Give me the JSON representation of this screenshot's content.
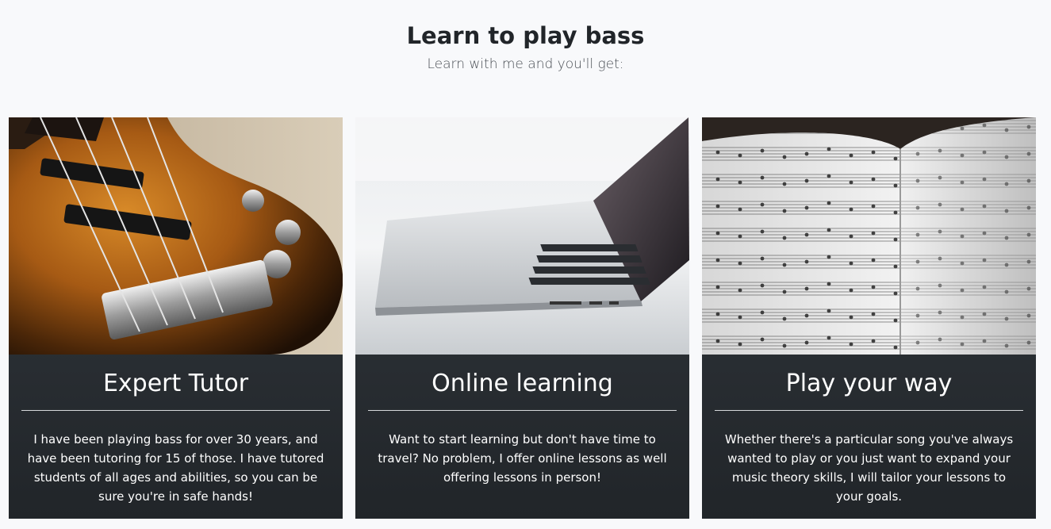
{
  "header": {
    "title": "Learn to play bass",
    "subtitle": "Learn with me and you'll get:"
  },
  "cards": [
    {
      "image": "bass-guitar-photo",
      "title": "Expert Tutor",
      "text": "I have been playing bass for over 30 years, and have been tutoring for 15 of those. I have tutored students of all ages and abilities, so you can be sure you're in safe hands!"
    },
    {
      "image": "laptop-photo",
      "title": "Online learning",
      "text": "Want to start learning but don't have time to travel? No problem, I offer online lessons as well offering lessons in person!"
    },
    {
      "image": "sheet-music-photo",
      "title": "Play your way",
      "text": "Whether there's a particular song you've always wanted to play or you just want to expand your music theory skills, I will tailor your lessons to your goals."
    }
  ],
  "colors": {
    "page_background": "#f8f9fb",
    "card_background": "#2b3035",
    "card_text": "#ffffff"
  }
}
